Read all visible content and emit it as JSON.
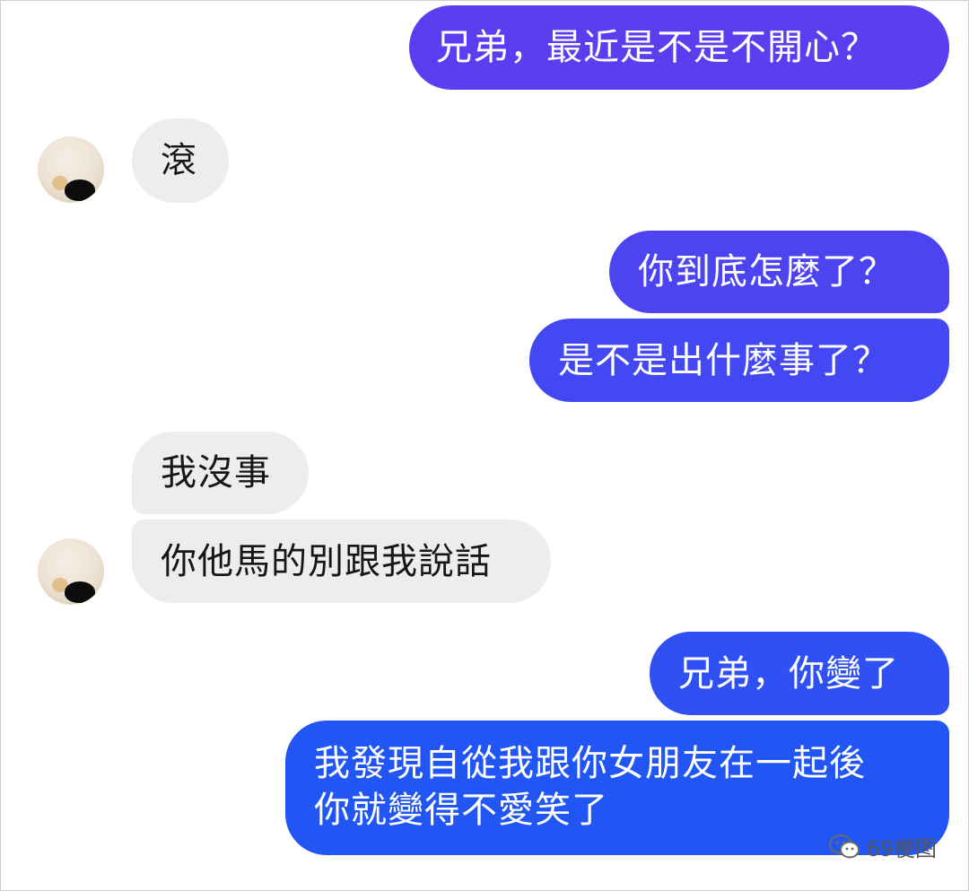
{
  "colors": {
    "outgoing_top": "#5b3ef0",
    "outgoing_bottom": "#1f57f3",
    "incoming": "#ededed"
  },
  "messages": [
    {
      "side": "out",
      "text": "兄弟，最近是不是不開心？"
    },
    {
      "side": "in",
      "text": "滾"
    },
    {
      "side": "out",
      "text": "你到底怎麼了？"
    },
    {
      "side": "out",
      "text": "是不是出什麼事了？"
    },
    {
      "side": "in",
      "text": "我沒事"
    },
    {
      "side": "in",
      "text": "你他馬的別跟我說話"
    },
    {
      "side": "out",
      "text": "兄弟，你變了"
    },
    {
      "side": "out",
      "lines": [
        "我發現自從我跟你女朋友在一起後",
        "你就變得不愛笑了"
      ]
    }
  ],
  "watermark": {
    "icon": "wechat-icon",
    "text": "69梗图"
  }
}
